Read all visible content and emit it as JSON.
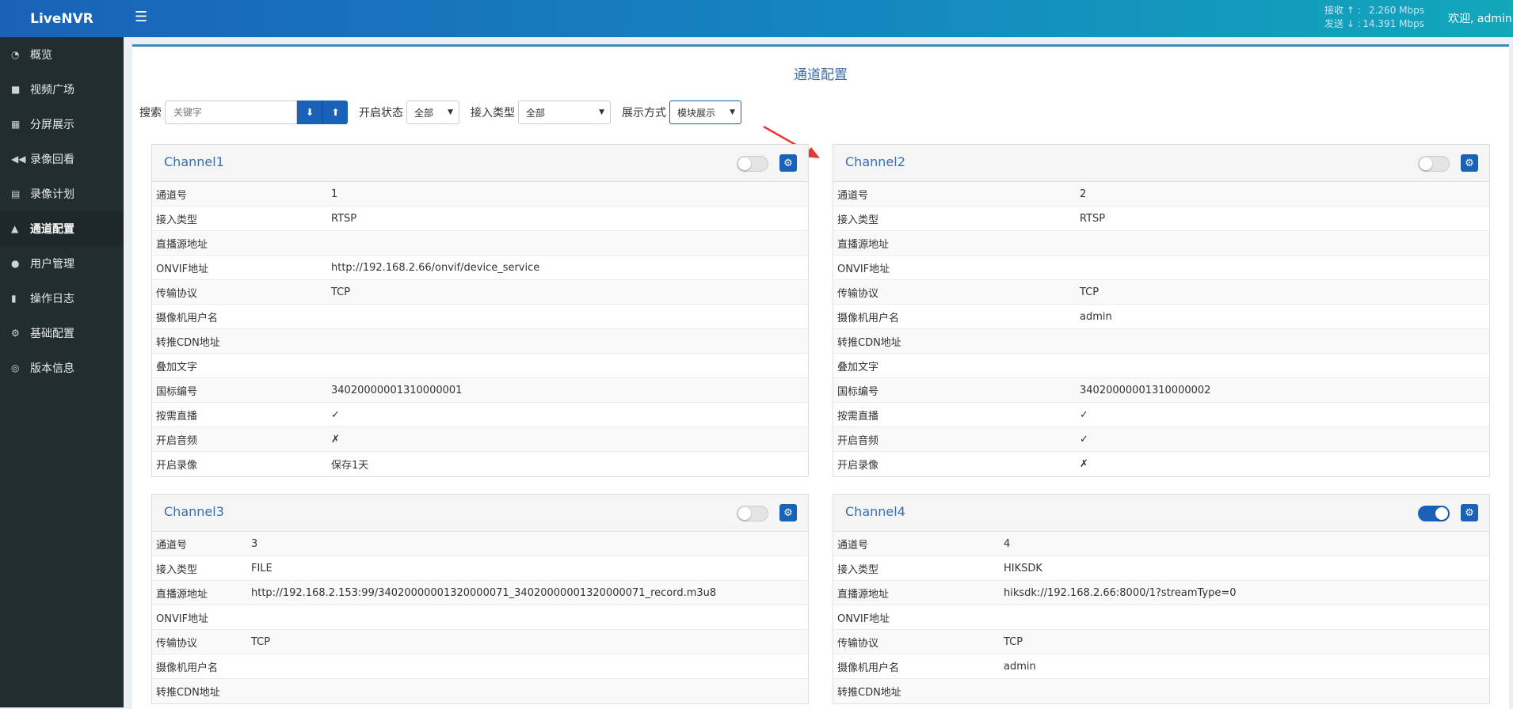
{
  "app": {
    "logo": "LiveNVR",
    "menu_icon": "menu-icon"
  },
  "rate": {
    "recv_label": "接收 ↑ :",
    "recv_value": "2.260 Mbps",
    "send_label": "发送 ↓ :",
    "send_value": "14.391 Mbps"
  },
  "user": {
    "welcome": "欢迎, admin"
  },
  "sidebar": {
    "items": [
      {
        "label": "概览",
        "icon": "dashboard-icon"
      },
      {
        "label": "视频广场",
        "icon": "video-camera-icon"
      },
      {
        "label": "分屏展示",
        "icon": "grid-icon"
      },
      {
        "label": "录像回看",
        "icon": "rewind-icon"
      },
      {
        "label": "录像计划",
        "icon": "calendar-icon"
      },
      {
        "label": "通道配置",
        "icon": "road-icon",
        "active": true
      },
      {
        "label": "用户管理",
        "icon": "users-icon"
      },
      {
        "label": "操作日志",
        "icon": "file-icon"
      },
      {
        "label": "基础配置",
        "icon": "cogs-icon"
      },
      {
        "label": "版本信息",
        "icon": "life-ring-icon"
      }
    ]
  },
  "page": {
    "title": "通道配置"
  },
  "toolbar": {
    "search_label": "搜索",
    "search_placeholder": "关键字",
    "import_icon": "download-icon",
    "export_icon": "upload-icon",
    "status_label": "开启状态",
    "status_value": "全部",
    "type_label": "接入类型",
    "type_value": "全部",
    "display_label": "展示方式",
    "display_value": "模块展示"
  },
  "channels": [
    {
      "name": "Channel1",
      "enabled": false,
      "rows": [
        {
          "k": "通道号",
          "v": "1"
        },
        {
          "k": "接入类型",
          "v": "RTSP"
        },
        {
          "k": "直播源地址",
          "v": ""
        },
        {
          "k": "ONVIF地址",
          "v": "http://192.168.2.66/onvif/device_service"
        },
        {
          "k": "传输协议",
          "v": "TCP"
        },
        {
          "k": "摄像机用户名",
          "v": ""
        },
        {
          "k": "转推CDN地址",
          "v": ""
        },
        {
          "k": "叠加文字",
          "v": ""
        },
        {
          "k": "国标编号",
          "v": "34020000001310000001"
        },
        {
          "k": "按需直播",
          "v": "✓"
        },
        {
          "k": "开启音频",
          "v": "✗"
        },
        {
          "k": "开启录像",
          "v": "保存1天"
        }
      ]
    },
    {
      "name": "Channel2",
      "enabled": false,
      "rows": [
        {
          "k": "通道号",
          "v": "2"
        },
        {
          "k": "接入类型",
          "v": "RTSP"
        },
        {
          "k": "直播源地址",
          "v": ""
        },
        {
          "k": "ONVIF地址",
          "v": ""
        },
        {
          "k": "传输协议",
          "v": "TCP"
        },
        {
          "k": "摄像机用户名",
          "v": "admin"
        },
        {
          "k": "转推CDN地址",
          "v": ""
        },
        {
          "k": "叠加文字",
          "v": ""
        },
        {
          "k": "国标编号",
          "v": "34020000001310000002"
        },
        {
          "k": "按需直播",
          "v": "✓"
        },
        {
          "k": "开启音频",
          "v": "✓"
        },
        {
          "k": "开启录像",
          "v": "✗"
        }
      ]
    },
    {
      "name": "Channel3",
      "enabled": false,
      "rows": [
        {
          "k": "通道号",
          "v": "3"
        },
        {
          "k": "接入类型",
          "v": "FILE"
        },
        {
          "k": "直播源地址",
          "v": "http://192.168.2.153:99/34020000001320000071_34020000001320000071_record.m3u8"
        },
        {
          "k": "ONVIF地址",
          "v": ""
        },
        {
          "k": "传输协议",
          "v": "TCP"
        },
        {
          "k": "摄像机用户名",
          "v": ""
        },
        {
          "k": "转推CDN地址",
          "v": ""
        }
      ]
    },
    {
      "name": "Channel4",
      "enabled": true,
      "rows": [
        {
          "k": "通道号",
          "v": "4"
        },
        {
          "k": "接入类型",
          "v": "HIKSDK"
        },
        {
          "k": "直播源地址",
          "v": "hiksdk://192.168.2.66:8000/1?streamType=0"
        },
        {
          "k": "ONVIF地址",
          "v": ""
        },
        {
          "k": "传输协议",
          "v": "TCP"
        },
        {
          "k": "摄像机用户名",
          "v": "admin"
        },
        {
          "k": "转推CDN地址",
          "v": ""
        }
      ]
    }
  ],
  "colors": {
    "primary": "#1a62b8",
    "sidebar": "#222d32",
    "title": "#3c6fa8",
    "arrow": "#e53935"
  }
}
